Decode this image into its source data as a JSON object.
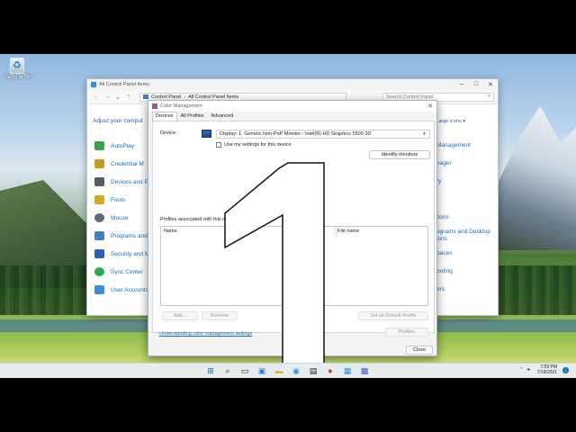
{
  "desktop": {
    "recycle_bin_label": "Recycle Bin"
  },
  "control_panel": {
    "title": "All Control Panel Items",
    "address_parts": [
      "Control Panel",
      "All Control Panel Items"
    ],
    "search_placeholder": "Search Control Panel",
    "adjust_text": "Adjust your comput",
    "view_by": "Large icons ▾",
    "items_left": [
      {
        "label": "AutoPlay",
        "color": "#3aa24a"
      },
      {
        "label": "Credential M",
        "color": "#c49a22"
      },
      {
        "label": "Devices and P",
        "color": "#555d66"
      },
      {
        "label": "Fonts",
        "color": "#d8a526"
      },
      {
        "label": "Mouse",
        "color": "#5f6a74"
      },
      {
        "label": "Programs and",
        "color": "#3f7fc4"
      },
      {
        "label": "Security and M",
        "color": "#2a61b8"
      },
      {
        "label": "Sync Center",
        "color": "#2fa84f"
      },
      {
        "label": "User Accounts",
        "color": "#3e8ad6"
      }
    ],
    "items_right": [
      "Management",
      "nager",
      "ry",
      "",
      "tions",
      "ograms and Desktop ions",
      "paces",
      "ooting",
      "ers"
    ]
  },
  "color_mgmt": {
    "title": "Color Management",
    "tabs": [
      "Devices",
      "All Profiles",
      "Advanced"
    ],
    "device_label": "Device:",
    "device_value": "Display: 1. Generic Non-PnP Monitor - Intel(R) HD Graphics 5500 3D",
    "use_settings": "Use my settings for this device",
    "identify": "Identify monitors",
    "profiles_label": "Profiles associated with this device:",
    "col_name": "Name",
    "col_file": "File name",
    "add": "Add...",
    "remove": "Remove",
    "set_default": "Set as Default Profile",
    "profiles_btn": "Profiles",
    "understanding": "Understanding color management settings",
    "close": "Close"
  },
  "taskbar": {
    "time": "7:59 PM",
    "date": "7/18/2021",
    "notif_count": "1"
  }
}
